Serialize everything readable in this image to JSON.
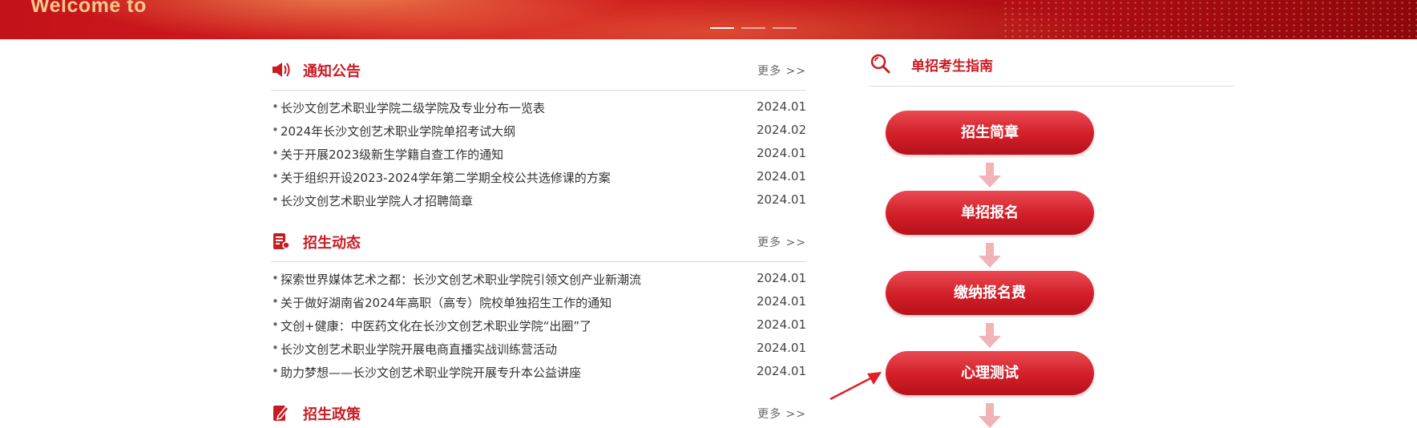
{
  "banner": {
    "text": "Welcome to",
    "slides": 3,
    "active_slide": 1
  },
  "notice": {
    "title": "通知公告",
    "more": "更多 >>",
    "items": [
      {
        "title": "长沙文创艺术职业学院二级学院及专业分布一览表",
        "date": "2024.01"
      },
      {
        "title": "2024年长沙文创艺术职业学院单招考试大纲",
        "date": "2024.02"
      },
      {
        "title": "关于开展2023级新生学籍自查工作的通知",
        "date": "2024.01"
      },
      {
        "title": "关于组织开设2023-2024学年第二学期全校公共选修课的方案",
        "date": "2024.01"
      },
      {
        "title": "长沙文创艺术职业学院人才招聘简章",
        "date": "2024.01"
      }
    ]
  },
  "admission_news": {
    "title": "招生动态",
    "more": "更多 >>",
    "items": [
      {
        "title": "探索世界媒体艺术之都：长沙文创艺术职业学院引领文创产业新潮流",
        "date": "2024.01"
      },
      {
        "title": "关于做好湖南省2024年高职（高专）院校单独招生工作的通知",
        "date": "2024.01"
      },
      {
        "title": "文创+健康：中医药文化在长沙文创艺术职业学院“出圈”了",
        "date": "2024.01"
      },
      {
        "title": "长沙文创艺术职业学院开展电商直播实战训练营活动",
        "date": "2024.01"
      },
      {
        "title": "助力梦想——长沙文创艺术职业学院开展专升本公益讲座",
        "date": "2024.01"
      }
    ]
  },
  "policy": {
    "title": "招生政策",
    "more": "更多 >>"
  },
  "guide": {
    "title": "单招考生指南",
    "steps": [
      "招生简章",
      "单招报名",
      "缴纳报名费",
      "心理测试"
    ]
  },
  "colors": {
    "accent": "#c81c23",
    "banner": "#c4121a",
    "arrow": "#f0b3b6"
  },
  "icons": {
    "notice": "megaphone-icon",
    "admission_news": "document-icon",
    "policy": "edit-icon",
    "guide": "search-icon"
  }
}
